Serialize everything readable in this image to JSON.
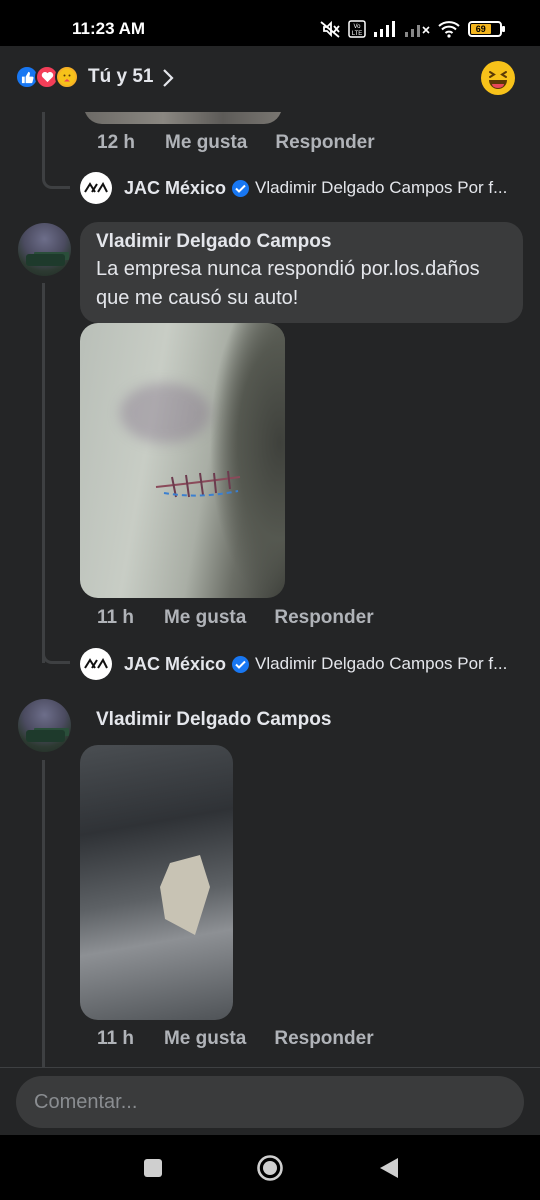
{
  "status_bar": {
    "time": "11:23 AM",
    "battery_level": "69",
    "volte_label": "Vo LTE"
  },
  "reactions": {
    "summary": "Tú y 51",
    "types": [
      "like-icon",
      "love-icon",
      "care-icon"
    ],
    "colors": {
      "like": "#1877f2",
      "love": "#f33e58",
      "care": "#f7b125"
    }
  },
  "thread": {
    "first_meta": {
      "time": "12 h",
      "like": "Me gusta",
      "reply": "Responder"
    },
    "reply_1": {
      "author": "JAC México",
      "preview": "Vladimir Delgado Campos Por f..."
    },
    "comment_1": {
      "author": "Vladimir Delgado Campos",
      "text": "La empresa nunca respondió por.los.daños que me causó su auto!",
      "meta": {
        "time": "11 h",
        "like": "Me gusta",
        "reply": "Responder"
      }
    },
    "reply_2": {
      "author": "JAC México",
      "preview": "Vladimir Delgado Campos Por f..."
    },
    "comment_2": {
      "author": "Vladimir Delgado Campos",
      "meta": {
        "time": "11 h",
        "like": "Me gusta",
        "reply": "Responder"
      }
    }
  },
  "composer": {
    "placeholder": "Comentar..."
  },
  "brand": {
    "verified_color": "#1877f2",
    "bubble_color": "#3a3b3c",
    "background": "#242526"
  }
}
